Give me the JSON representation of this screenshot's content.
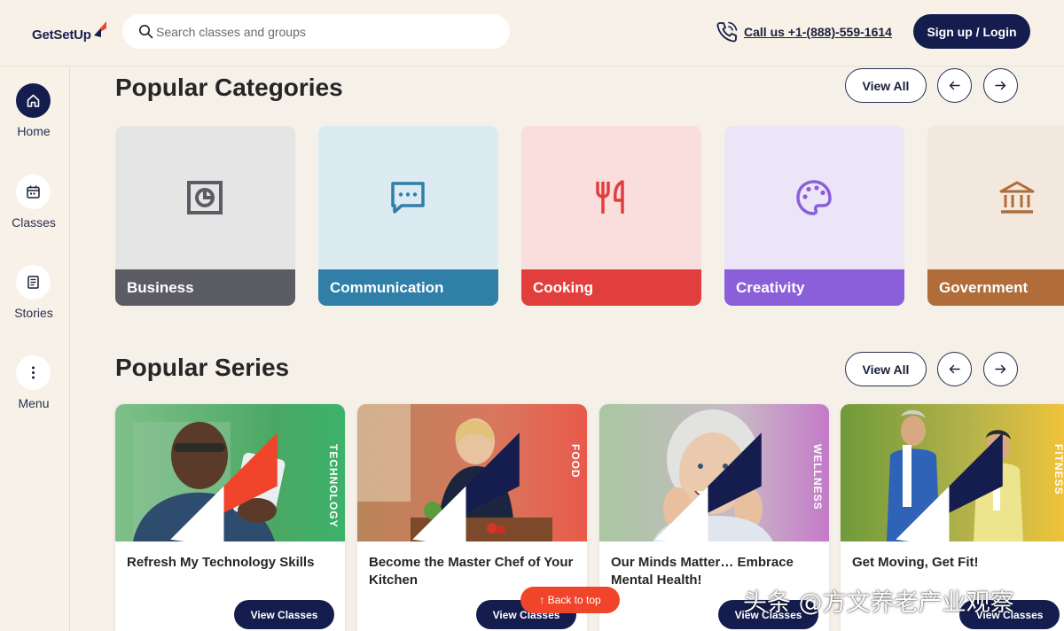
{
  "header": {
    "logo_text": "GetSetUp",
    "search_placeholder": "Search classes and groups",
    "call_text": "Call us +1-(888)-559-1614",
    "login_label": "Sign up / Login"
  },
  "sidebar": {
    "items": [
      {
        "label": "Home",
        "icon": "home-icon",
        "active": true
      },
      {
        "label": "Classes",
        "icon": "calendar-icon",
        "active": false
      },
      {
        "label": "Stories",
        "icon": "document-icon",
        "active": false
      },
      {
        "label": "Menu",
        "icon": "more-vertical-icon",
        "active": false
      }
    ]
  },
  "categories": {
    "title": "Popular Categories",
    "view_all": "View All",
    "items": [
      {
        "label": "Business",
        "icon": "chart-icon",
        "bg": "#e5e5e5",
        "bar": "#5c5c64",
        "icon_color": "#5c5c64"
      },
      {
        "label": "Communication",
        "icon": "chat-icon",
        "bg": "#dcebf2",
        "bar": "#2f7fa8",
        "icon_color": "#2f7fa8"
      },
      {
        "label": "Cooking",
        "icon": "fork-knife-icon",
        "bg": "#fadede",
        "bar": "#e23e3e",
        "icon_color": "#e23e3e"
      },
      {
        "label": "Creativity",
        "icon": "palette-icon",
        "bg": "#ebe5f7",
        "bar": "#8b5fd9",
        "icon_color": "#8b5fd9"
      },
      {
        "label": "Government",
        "icon": "bank-icon",
        "bg": "#f3e8dd",
        "bar": "#b06c39",
        "icon_color": "#b06c39"
      }
    ]
  },
  "series": {
    "title": "Popular Series",
    "view_all": "View All",
    "button_label": "View Classes",
    "items": [
      {
        "title": "Refresh My Technology Skills",
        "tag": "TECHNOLOGY",
        "accent": "#3bb26a"
      },
      {
        "title": "Become the Master Chef of Your Kitchen",
        "tag": "FOOD",
        "accent": "#e85a4a"
      },
      {
        "title": "Our Minds Matter… Embrace Mental Health!",
        "tag": "WELLNESS",
        "accent": "#c47ac9"
      },
      {
        "title": "Get Moving, Get Fit!",
        "tag": "FITNESS",
        "accent": "#f3c43a"
      }
    ]
  },
  "back_to_top": "Back to top",
  "watermark": "头条 @方文养老产业观察",
  "colors": {
    "brand_navy": "#151d4e",
    "accent_orange": "#f0452b"
  }
}
